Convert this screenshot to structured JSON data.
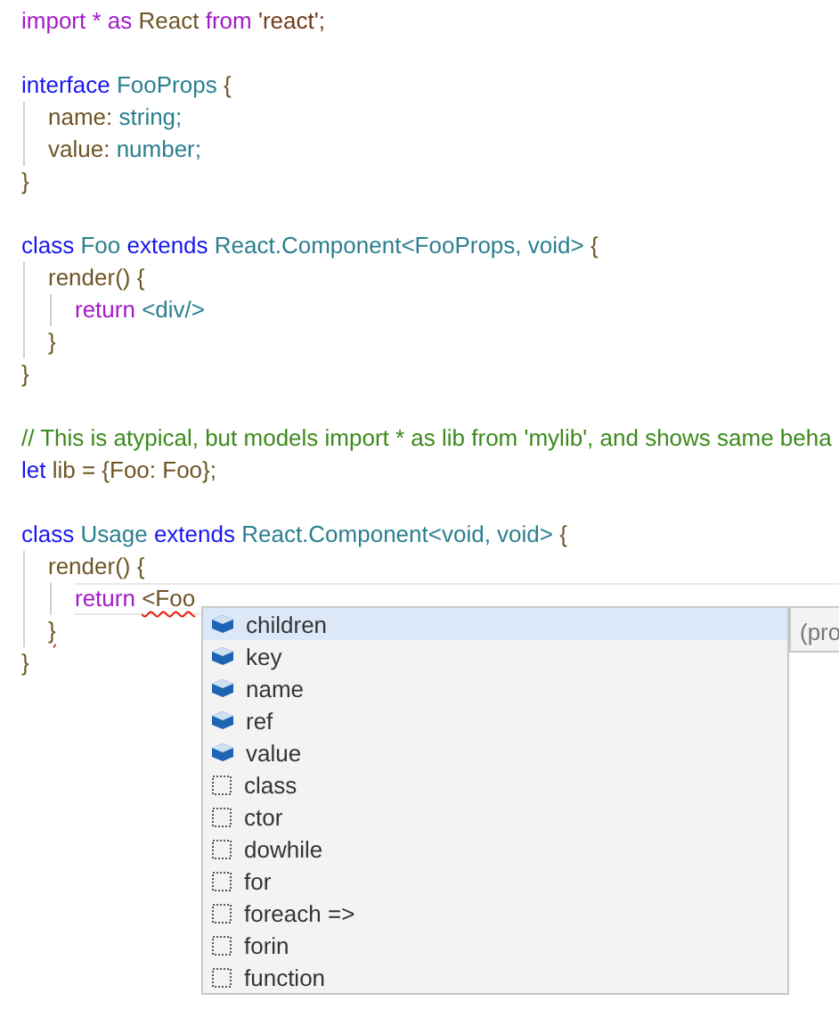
{
  "editor": {
    "lines": [
      {
        "kind": "code",
        "current": false,
        "tokens": [
          {
            "text": "import",
            "kind": "keyword"
          },
          {
            "text": " * ",
            "kind": "keyword"
          },
          {
            "text": "as",
            "kind": "keyword"
          },
          {
            "text": " React ",
            "kind": "ident"
          },
          {
            "text": "from",
            "kind": "keyword"
          },
          {
            "text": " 'react';",
            "kind": "string"
          }
        ]
      },
      {
        "kind": "blank"
      },
      {
        "kind": "code",
        "current": false,
        "tokens": [
          {
            "text": "interface",
            "kind": "declare"
          },
          {
            "text": " FooProps ",
            "kind": "type"
          },
          {
            "text": "{",
            "kind": "punct"
          }
        ],
        "children": [
          {
            "kind": "code",
            "current": false,
            "tokens": [
              {
                "text": "name: ",
                "kind": "ident"
              },
              {
                "text": "string;",
                "kind": "type"
              }
            ]
          },
          {
            "kind": "code",
            "current": false,
            "tokens": [
              {
                "text": "value: ",
                "kind": "ident"
              },
              {
                "text": "number;",
                "kind": "type"
              }
            ]
          }
        ]
      },
      {
        "kind": "code",
        "current": false,
        "tokens": [
          {
            "text": "}",
            "kind": "punct"
          }
        ]
      },
      {
        "kind": "blank"
      },
      {
        "kind": "code",
        "current": false,
        "tokens": [
          {
            "text": "class",
            "kind": "declare"
          },
          {
            "text": " Foo ",
            "kind": "type"
          },
          {
            "text": "extends",
            "kind": "declare"
          },
          {
            "text": " React.Component",
            "kind": "type"
          },
          {
            "text": "<FooProps, void> ",
            "kind": "type"
          },
          {
            "text": "{",
            "kind": "punct"
          }
        ],
        "children": [
          {
            "kind": "code",
            "current": false,
            "tokens": [
              {
                "text": "render() {",
                "kind": "ident"
              }
            ],
            "children": [
              {
                "kind": "code",
                "current": false,
                "tokens": [
                  {
                    "text": "return",
                    "kind": "keyword"
                  },
                  {
                    "text": " <div/>",
                    "kind": "type"
                  }
                ]
              }
            ]
          },
          {
            "kind": "code",
            "current": false,
            "tokens": [
              {
                "text": "}",
                "kind": "ident"
              }
            ]
          }
        ]
      },
      {
        "kind": "code",
        "current": false,
        "tokens": [
          {
            "text": "}",
            "kind": "punct"
          }
        ]
      },
      {
        "kind": "blank"
      },
      {
        "kind": "code",
        "current": false,
        "tokens": [
          {
            "text": "// This is atypical, but models import * as lib from 'mylib', and shows same beha",
            "kind": "comment"
          }
        ]
      },
      {
        "kind": "code",
        "current": false,
        "tokens": [
          {
            "text": "let",
            "kind": "declare"
          },
          {
            "text": " lib = {Foo: Foo};",
            "kind": "ident"
          }
        ]
      },
      {
        "kind": "blank"
      },
      {
        "kind": "code",
        "current": false,
        "tokens": [
          {
            "text": "class",
            "kind": "declare"
          },
          {
            "text": " Usage ",
            "kind": "type"
          },
          {
            "text": "extends",
            "kind": "declare"
          },
          {
            "text": " React.Component",
            "kind": "type"
          },
          {
            "text": "<void, void> ",
            "kind": "type"
          },
          {
            "text": "{",
            "kind": "punct"
          }
        ],
        "children": [
          {
            "kind": "code",
            "current": false,
            "tokens": [
              {
                "text": "render() {",
                "kind": "ident"
              }
            ],
            "children": [
              {
                "kind": "code",
                "current": true,
                "tokens": [
                  {
                    "text": "return ",
                    "kind": "keyword"
                  },
                  {
                    "text": "<Foo",
                    "kind": "error"
                  }
                ]
              }
            ]
          },
          {
            "kind": "code",
            "current": false,
            "tokens": [
              {
                "text": "}",
                "kind": "error"
              }
            ]
          }
        ]
      },
      {
        "kind": "code",
        "current": false,
        "tokens": [
          {
            "text": "}",
            "kind": "punct"
          }
        ]
      }
    ]
  },
  "suggestions": {
    "items": [
      {
        "label": "children",
        "kind": "property",
        "selected": true
      },
      {
        "label": "key",
        "kind": "property",
        "selected": false
      },
      {
        "label": "name",
        "kind": "property",
        "selected": false
      },
      {
        "label": "ref",
        "kind": "property",
        "selected": false
      },
      {
        "label": "value",
        "kind": "property",
        "selected": false
      },
      {
        "label": "class",
        "kind": "snippet",
        "selected": false
      },
      {
        "label": "ctor",
        "kind": "snippet",
        "selected": false
      },
      {
        "label": "dowhile",
        "kind": "snippet",
        "selected": false
      },
      {
        "label": "for",
        "kind": "snippet",
        "selected": false
      },
      {
        "label": "foreach =>",
        "kind": "snippet",
        "selected": false
      },
      {
        "label": "forin",
        "kind": "snippet",
        "selected": false
      },
      {
        "label": "function",
        "kind": "snippet",
        "selected": false
      }
    ],
    "detail": "(pro"
  }
}
